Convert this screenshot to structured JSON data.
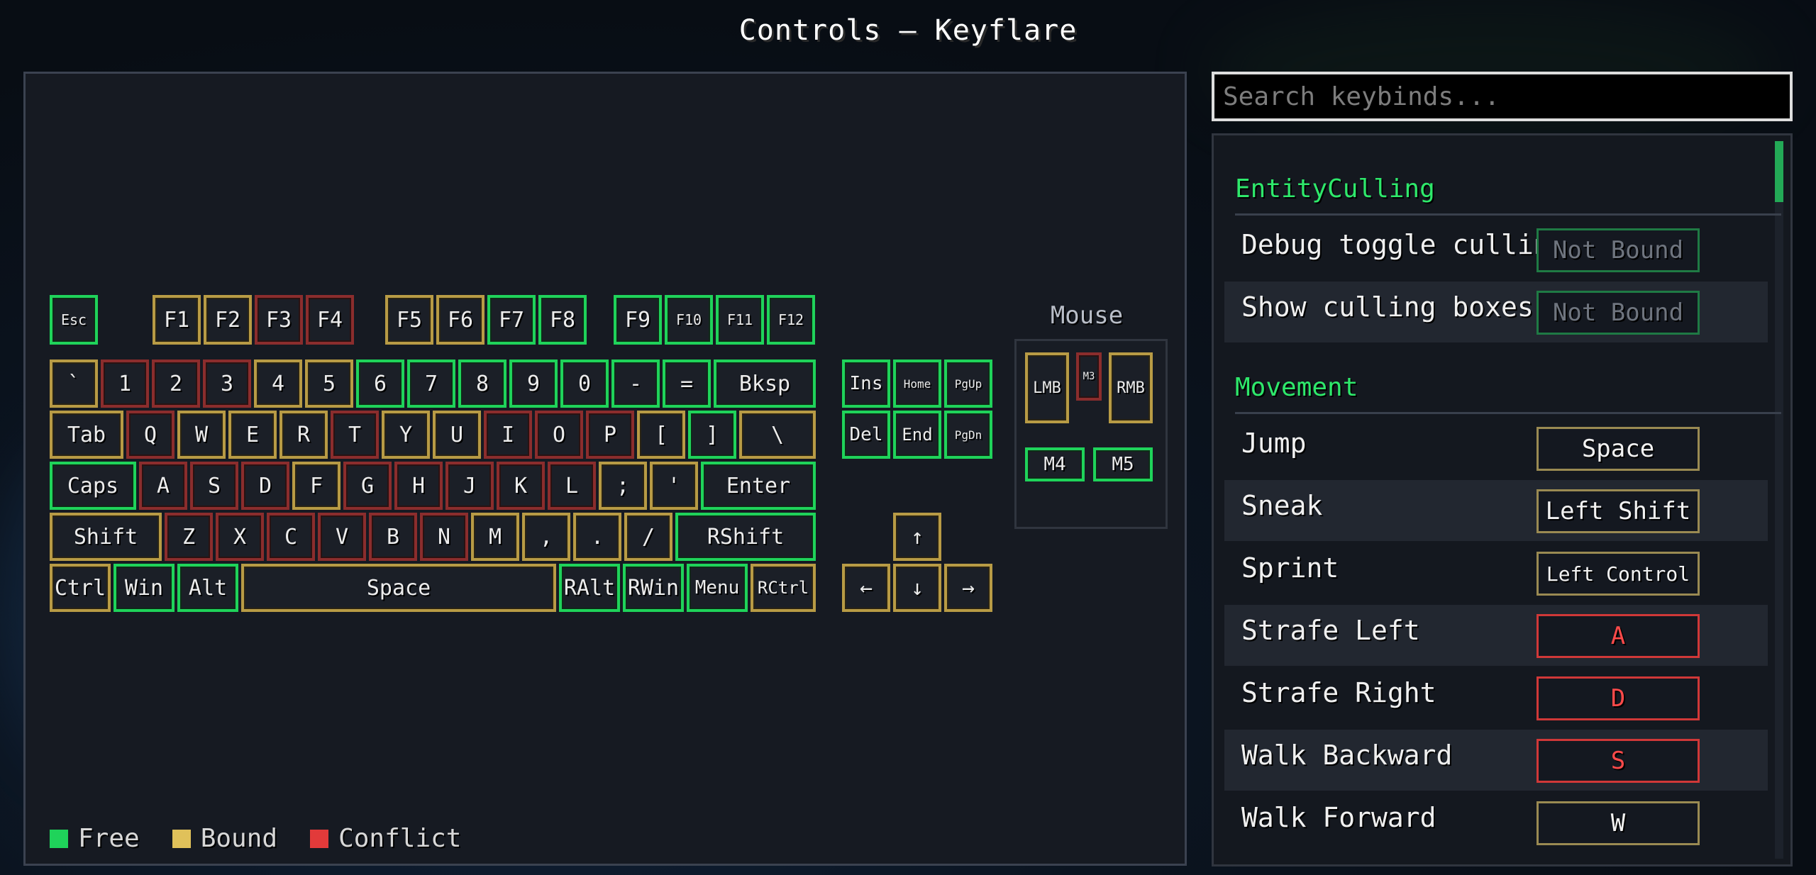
{
  "title": "Controls — Keyflare",
  "colors": {
    "free": "#1fd35a",
    "bound": "#b89b45",
    "conflict": "#8b2d2d",
    "category": "#2ee86b"
  },
  "keyboard": {
    "esc": "Esc",
    "f1": "F1",
    "f2": "F2",
    "f3": "F3",
    "f4": "F4",
    "f5": "F5",
    "f6": "F6",
    "f7": "F7",
    "f8": "F8",
    "f9": "F9",
    "f10": "F10",
    "f11": "F11",
    "f12": "F12",
    "grave": "`",
    "k1": "1",
    "k2": "2",
    "k3": "3",
    "k4": "4",
    "k5": "5",
    "k6": "6",
    "k7": "7",
    "k8": "8",
    "k9": "9",
    "k0": "0",
    "minus": "-",
    "equals": "=",
    "bksp": "Bksp",
    "tab": "Tab",
    "q": "Q",
    "w": "W",
    "e": "E",
    "r": "R",
    "t": "T",
    "y": "Y",
    "u": "U",
    "i": "I",
    "o": "O",
    "p": "P",
    "lbracket": "[",
    "rbracket": "]",
    "backslash": "\\",
    "caps": "Caps",
    "a": "A",
    "s": "S",
    "d": "D",
    "f": "F",
    "g": "G",
    "h": "H",
    "j": "J",
    "k": "K",
    "l": "L",
    "semicolon": ";",
    "quote": "'",
    "enter": "Enter",
    "shift": "Shift",
    "z": "Z",
    "x": "X",
    "c": "C",
    "v": "V",
    "b": "B",
    "n": "N",
    "m": "M",
    "comma": ",",
    "period": ".",
    "slash": "/",
    "rshift": "RShift",
    "ctrl": "Ctrl",
    "win": "Win",
    "alt": "Alt",
    "space": "Space",
    "ralt": "RAlt",
    "rwin": "RWin",
    "menu": "Menu",
    "rctrl": "RCtrl",
    "ins": "Ins",
    "home": "Home",
    "pgup": "PgUp",
    "del": "Del",
    "end": "End",
    "pgdn": "PgDn",
    "up": "↑",
    "left": "←",
    "down": "↓",
    "right": "→"
  },
  "mouse": {
    "label": "Mouse",
    "lmb": "LMB",
    "m3": "M3",
    "rmb": "RMB",
    "m4": "M4",
    "m5": "M5"
  },
  "legend": {
    "free": "Free",
    "bound": "Bound",
    "conflict": "Conflict"
  },
  "search": {
    "placeholder": "Search keybinds..."
  },
  "categories": [
    {
      "name": "EntityCulling",
      "items": [
        {
          "label": "Debug toggle culling",
          "binding": "Not Bound"
        },
        {
          "label": "Show culling boxes",
          "binding": "Not Bound"
        }
      ]
    },
    {
      "name": "Movement",
      "items": [
        {
          "label": "Jump",
          "binding": "Space"
        },
        {
          "label": "Sneak",
          "binding": "Left Shift"
        },
        {
          "label": "Sprint",
          "binding": "Left Control"
        },
        {
          "label": "Strafe Left",
          "binding": "A"
        },
        {
          "label": "Strafe Right",
          "binding": "D"
        },
        {
          "label": "Walk Backward",
          "binding": "S"
        },
        {
          "label": "Walk Forward",
          "binding": "W"
        }
      ]
    }
  ]
}
